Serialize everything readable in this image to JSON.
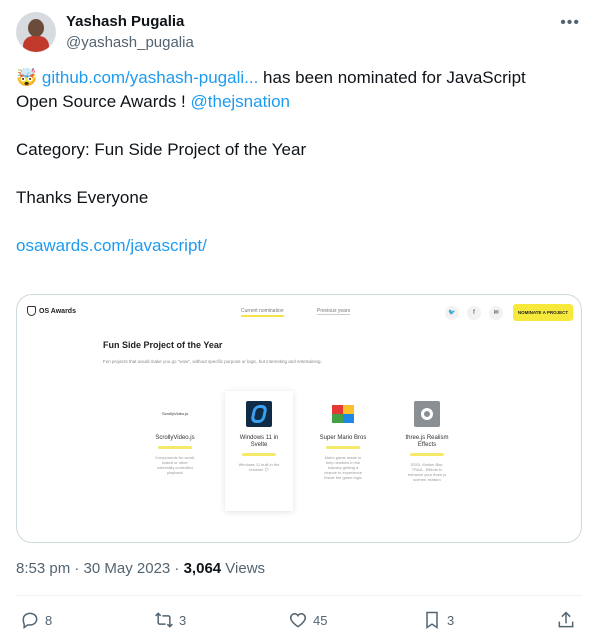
{
  "author": {
    "name": "Yashash Pugalia",
    "handle": "@yashash_pugalia"
  },
  "tweet": {
    "emoji": "🤯",
    "link1": "github.com/yashash-pugali...",
    "line1_rest": " has been nominated for JavaScript",
    "line2_start": "Open Source Awards ! ",
    "mention": "@thejsnation",
    "category": "Category: Fun Side Project of the Year",
    "thanks": "Thanks Everyone",
    "link2": "osawards.com/javascript/"
  },
  "card": {
    "logo_text": "OS Awards",
    "nav_current": "Current nomination",
    "nav_previous": "Previous years",
    "nominate_label": "NOMINATE A PROJECT",
    "section_title": "Fun Side Project of the Year",
    "section_subtitle": "Fun projects that would make you go \"wow\", without specific purpose or logic, but interesting and entertaining.",
    "projects": [
      {
        "logo_text": "ScrollyVideo.js",
        "title": "ScrollyVideo.js",
        "desc": "Components for scroll-based or other externally controlled playback"
      },
      {
        "title": "Windows 11 in Svelte",
        "desc": "Windows 11 built in the browser 😊"
      },
      {
        "title": "Super Mario Bros",
        "desc": "Mario game made to help newbies in the industry getting a chance to experience inside the game logic"
      },
      {
        "title": "three.js Realism Effects",
        "desc": "SSGI, Motion Blur, TRAA - Effects to enhance your three.js scenes' realism"
      }
    ]
  },
  "meta": {
    "time_date": "8:53 pm · 30 May 2023 · ",
    "views_count": "3,064",
    "views_label": " Views"
  },
  "actions": {
    "replies": "8",
    "retweets": "3",
    "likes": "45",
    "bookmarks": "3"
  },
  "colors": {
    "link": "#1d9bf0",
    "secondary_text": "#536471",
    "accent_yellow": "#f7e93b"
  }
}
